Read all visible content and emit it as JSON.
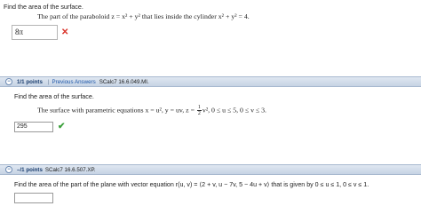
{
  "q1": {
    "title": "Find the area of the surface.",
    "prompt": "The part of the paraboloid  z = x² + y²  that lies inside the cylinder  x² + y² = 4.",
    "answer": "8π",
    "status_icon": "x-icon",
    "status_color": "#d9342b"
  },
  "q2": {
    "header": {
      "points": "1/1 points",
      "separator": "|",
      "previous_answers": "Previous Answers",
      "question_id": "SCalc7 16.6.049.MI."
    },
    "title": "Find the area of the surface.",
    "prompt_prefix": "The surface with parametric equations  x = u², y = uv, z = ",
    "frac_num": "1",
    "frac_den": "2",
    "prompt_suffix": "v², 0 ≤ u ≤ 5, 0 ≤ v ≤ 3.",
    "answer": "295",
    "status_icon": "check-icon",
    "status_color": "#3aa03a"
  },
  "q3": {
    "header": {
      "points": "–/1 points",
      "question_id": "SCalc7 16.6.507.XP."
    },
    "prompt": "Find the area of the part of the plane with vector equation  r(u, v) = ⟨2 + v, u − 7v, 5 − 4u + v⟩  that is given by  0 ≤ u ≤ 1, 0 ≤ v ≤ 1.",
    "answer": ""
  },
  "colors": {
    "header_bg": "#c6d3e4",
    "link": "#1d56a8"
  }
}
